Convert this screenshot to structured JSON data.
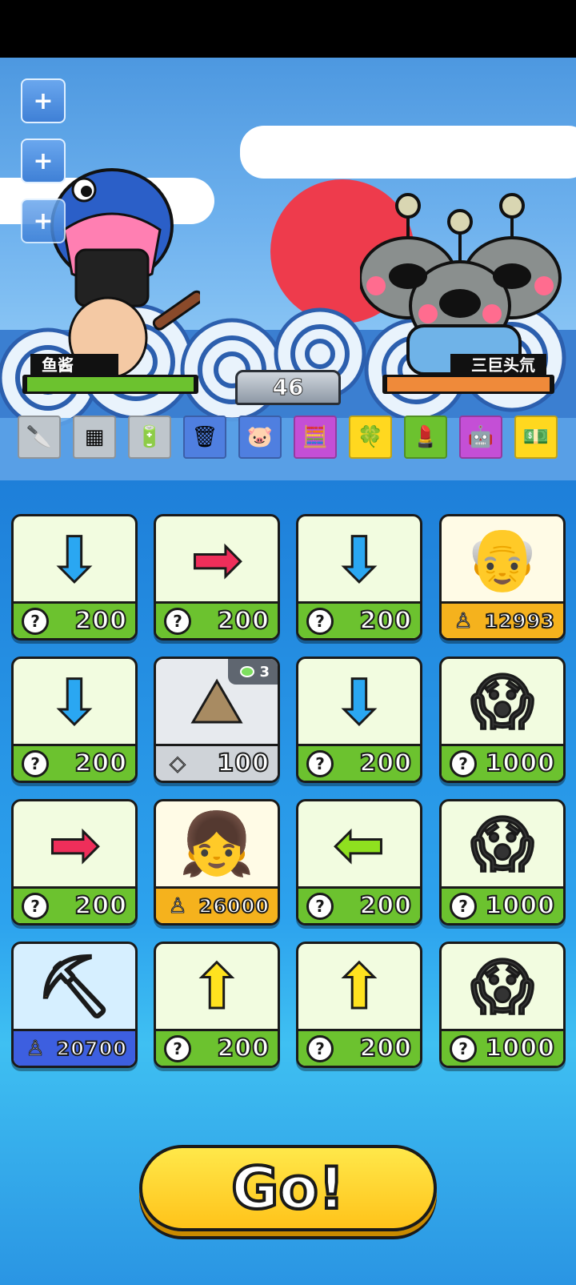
{
  "side_buttons": [
    {
      "label": "+"
    },
    {
      "label": "+"
    },
    {
      "label": "+"
    }
  ],
  "player": {
    "name": "鱼酱",
    "hp_fraction": 1.0,
    "hp_color": "#6cc22f"
  },
  "enemy": {
    "name": "三巨头氘",
    "hp_fraction": 1.0,
    "hp_color": "#ef8a3a"
  },
  "turn_counter": "46",
  "items": [
    {
      "icon": "cleaver-icon",
      "glyph": "🔪",
      "bg": "#bfc6cc"
    },
    {
      "icon": "circuit-board-icon",
      "glyph": "▦",
      "bg": "#bfc6cc"
    },
    {
      "icon": "battery-icon",
      "glyph": "🔋",
      "bg": "#bfc6cc"
    },
    {
      "icon": "trash-can-icon",
      "glyph": "🗑",
      "bg": "#4f7fe0"
    },
    {
      "icon": "piggy-bank-icon",
      "glyph": "🐷",
      "bg": "#4f7fe0"
    },
    {
      "icon": "calculator-icon",
      "glyph": "🧮",
      "bg": "#c44fd6"
    },
    {
      "icon": "four-leaf-clover-icon",
      "glyph": "🍀",
      "bg": "#ffd81f"
    },
    {
      "icon": "lipstick-icon",
      "glyph": "💄",
      "bg": "#6cc22f"
    },
    {
      "icon": "robot-toy-icon",
      "glyph": "🤖",
      "bg": "#c44fd6"
    },
    {
      "icon": "cash-stack-icon",
      "glyph": "💵",
      "bg": "#ffd81f"
    }
  ],
  "cards": [
    {
      "art": "blue-down-arrow",
      "glyph": "⬇",
      "glyph_color": "#2aa7f2",
      "footer": "green",
      "footer_icon": "question-icon",
      "icon_text": "?",
      "price": "200"
    },
    {
      "art": "red-right-arrow",
      "glyph": "➡",
      "glyph_color": "#ee2e5a",
      "footer": "green",
      "footer_icon": "question-icon",
      "icon_text": "?",
      "price": "200"
    },
    {
      "art": "blue-down-arrow",
      "glyph": "⬇",
      "glyph_color": "#2aa7f2",
      "footer": "green",
      "footer_icon": "question-icon",
      "icon_text": "?",
      "price": "200"
    },
    {
      "art": "scientist-portrait",
      "glyph": "👴",
      "glyph_color": "#555",
      "footer": "orange",
      "footer_icon": "person-icon",
      "icon_text": "♙",
      "price": "12993",
      "bg": "#fffbe6"
    },
    {
      "art": "blue-down-arrow",
      "glyph": "⬇",
      "glyph_color": "#2aa7f2",
      "footer": "green",
      "footer_icon": "question-icon",
      "icon_text": "?",
      "price": "200"
    },
    {
      "art": "rock-pile",
      "glyph": "⛰",
      "glyph_color": "#a88b62",
      "footer": "gray",
      "footer_icon": "diamond-icon",
      "icon_text": "◇",
      "price": "100",
      "bg": "#e7eaee",
      "badge": "3"
    },
    {
      "art": "blue-down-arrow",
      "glyph": "⬇",
      "glyph_color": "#2aa7f2",
      "footer": "green",
      "footer_icon": "question-icon",
      "icon_text": "?",
      "price": "200"
    },
    {
      "art": "scream-figure",
      "glyph": "😱",
      "glyph_color": "#333",
      "footer": "green",
      "footer_icon": "question-icon",
      "icon_text": "?",
      "price": "1000"
    },
    {
      "art": "red-right-arrow",
      "glyph": "➡",
      "glyph_color": "#ee2e5a",
      "footer": "green",
      "footer_icon": "question-icon",
      "icon_text": "?",
      "price": "200"
    },
    {
      "art": "girl-portrait",
      "glyph": "👧",
      "glyph_color": "#333",
      "footer": "orange",
      "footer_icon": "person-icon",
      "icon_text": "♙",
      "price": "26000",
      "bg": "#fffbe6"
    },
    {
      "art": "green-left-arrow",
      "glyph": "⬅",
      "glyph_color": "#8fe01f",
      "footer": "green",
      "footer_icon": "question-icon",
      "icon_text": "?",
      "price": "200"
    },
    {
      "art": "scream-figure",
      "glyph": "😱",
      "glyph_color": "#333",
      "footer": "green",
      "footer_icon": "question-icon",
      "icon_text": "?",
      "price": "1000"
    },
    {
      "art": "miner-portrait",
      "glyph": "⛏",
      "glyph_color": "#e8a21a",
      "footer": "blue",
      "footer_icon": "person-icon",
      "icon_text": "♙",
      "price": "20700",
      "bg": "#d6efff"
    },
    {
      "art": "yellow-up-arrow",
      "glyph": "⬆",
      "glyph_color": "#ffe21f",
      "footer": "green",
      "footer_icon": "question-icon",
      "icon_text": "?",
      "price": "200"
    },
    {
      "art": "yellow-up-arrow",
      "glyph": "⬆",
      "glyph_color": "#ffe21f",
      "footer": "green",
      "footer_icon": "question-icon",
      "icon_text": "?",
      "price": "200"
    },
    {
      "art": "scream-figure",
      "glyph": "😱",
      "glyph_color": "#333",
      "footer": "green",
      "footer_icon": "question-icon",
      "icon_text": "?",
      "price": "1000"
    }
  ],
  "go_button": {
    "label": "Go!"
  }
}
